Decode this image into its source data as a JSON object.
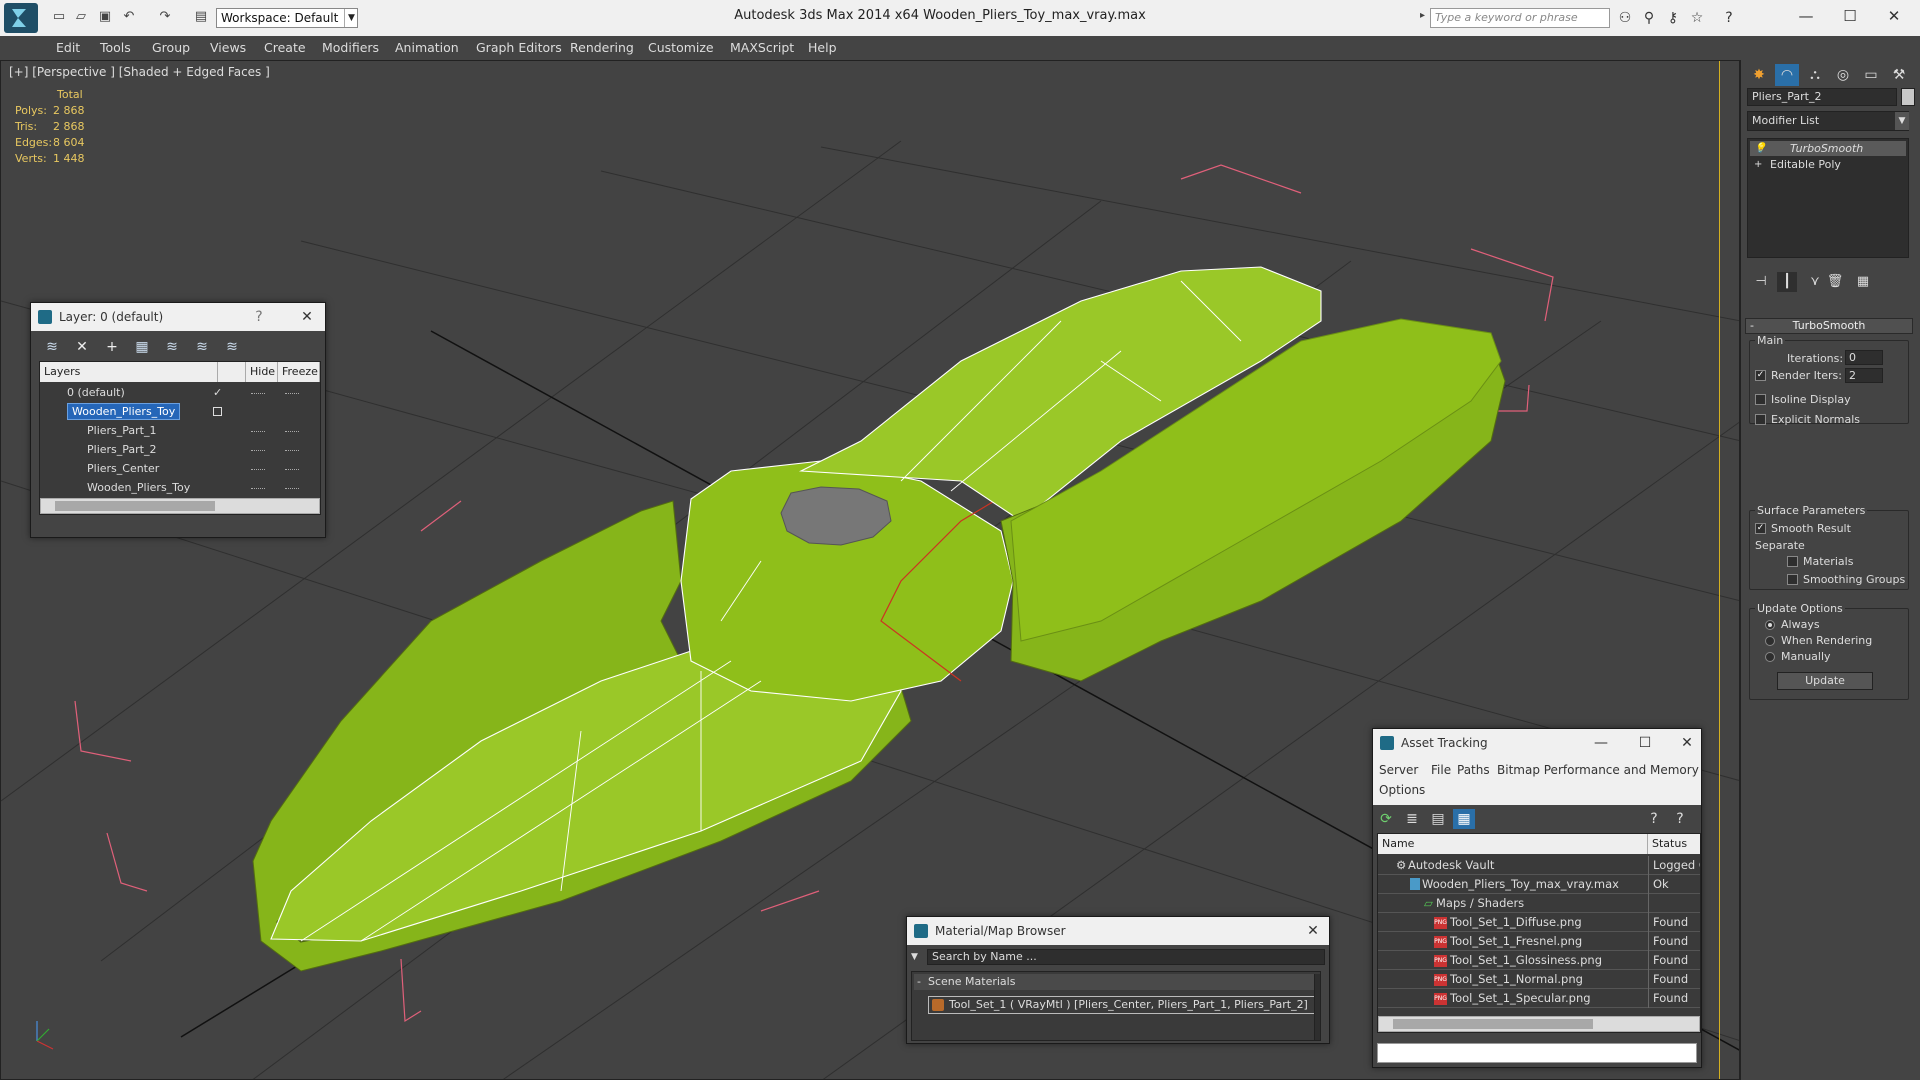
{
  "window": {
    "title": "Autodesk 3ds Max  2014 x64      Wooden_Pliers_Toy_max_vray.max",
    "workspace": "Workspace: Default",
    "search_placeholder": "Type a keyword or phrase"
  },
  "menu": [
    "Edit",
    "Tools",
    "Group",
    "Views",
    "Create",
    "Modifiers",
    "Animation",
    "Graph Editors",
    "Rendering",
    "Customize",
    "MAXScript",
    "Help"
  ],
  "viewport": {
    "label": "[+] [Perspective ] [Shaded + Edged Faces ]",
    "stats": {
      "header": "Total",
      "rows": [
        {
          "label": "Polys:",
          "value": "2 868"
        },
        {
          "label": "Tris:",
          "value": "2 868"
        },
        {
          "label": "Edges:",
          "value": "8 604"
        },
        {
          "label": "Verts:",
          "value": "1 448"
        }
      ]
    },
    "colors": {
      "mesh": "#8fbf1a",
      "wire": "#ffffff",
      "bbox": "#e0607a",
      "grid": "#2e2e2e"
    }
  },
  "layer_dialog": {
    "title": "Layer: 0 (default)",
    "help": "?",
    "columns": {
      "name": "Layers",
      "hide": "Hide",
      "freeze": "Freeze"
    },
    "rows": [
      {
        "name": "0 (default)"
      },
      {
        "name": "Wooden_Pliers_Toy"
      },
      {
        "name": "Pliers_Part_1"
      },
      {
        "name": "Pliers_Part_2"
      },
      {
        "name": "Pliers_Center"
      },
      {
        "name": "Wooden_Pliers_Toy"
      }
    ]
  },
  "command_panel": {
    "object_name": "Pliers_Part_2",
    "modifier_list": "Modifier List",
    "stack": [
      "TurboSmooth",
      "Editable Poly"
    ],
    "rollout_title": "TurboSmooth",
    "main_label": "Main",
    "iterations_label": "Iterations:",
    "iterations_value": "0",
    "render_iters_label": "Render Iters:",
    "render_iters_value": "2",
    "isoline": "Isoline Display",
    "explicit_normals": "Explicit Normals",
    "surface_params": "Surface Parameters",
    "smooth_result": "Smooth Result",
    "separate": "Separate",
    "materials": "Materials",
    "smoothing_groups": "Smoothing Groups",
    "update_options": "Update Options",
    "always": "Always",
    "when_rendering": "When Rendering",
    "manually": "Manually",
    "update_button": "Update"
  },
  "material_browser": {
    "title": "Material/Map Browser",
    "search_placeholder": "Search by Name ...",
    "section": "Scene Materials",
    "item": "Tool_Set_1  ( VRayMtl )  [Pliers_Center, Pliers_Part_1, Pliers_Part_2]"
  },
  "asset_tracking": {
    "title": "Asset Tracking",
    "menu": [
      "Server",
      "File",
      "Paths",
      "Bitmap Performance and Memory",
      "Options"
    ],
    "columns": {
      "name": "Name",
      "status": "Status"
    },
    "rows": [
      {
        "name": "Autodesk Vault",
        "status": "Logged C"
      },
      {
        "name": "Wooden_Pliers_Toy_max_vray.max",
        "status": "Ok"
      },
      {
        "name": "Maps / Shaders",
        "status": ""
      },
      {
        "name": "Tool_Set_1_Diffuse.png",
        "status": "Found"
      },
      {
        "name": "Tool_Set_1_Fresnel.png",
        "status": "Found"
      },
      {
        "name": "Tool_Set_1_Glossiness.png",
        "status": "Found"
      },
      {
        "name": "Tool_Set_1_Normal.png",
        "status": "Found"
      },
      {
        "name": "Tool_Set_1_Specular.png",
        "status": "Found"
      }
    ],
    "png_badge": "PNG"
  }
}
